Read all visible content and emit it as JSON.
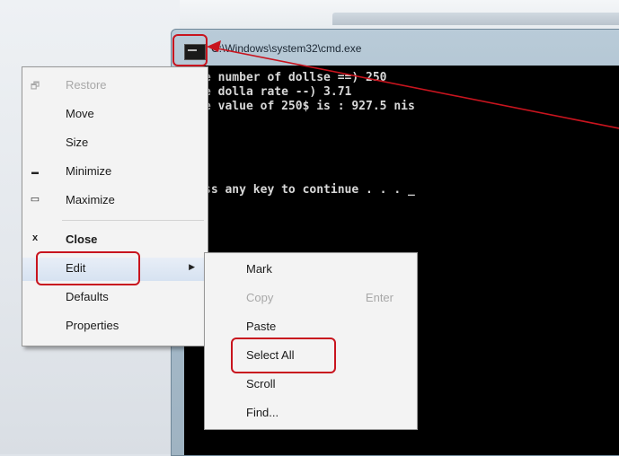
{
  "window": {
    "title": "C:\\Windows\\system32\\cmd.exe",
    "console_lines": [
      "e number of dollse ==) 250",
      "e dolla rate --) 3.71",
      "e value of 250$ is : 927.5 nis",
      "ss any key to continue . . . _"
    ]
  },
  "system_menu": {
    "items": [
      {
        "icon": "restore-icon",
        "glyph": "🗗",
        "label": "Restore",
        "enabled": false
      },
      {
        "icon": "",
        "glyph": "",
        "label": "Move",
        "enabled": true
      },
      {
        "icon": "",
        "glyph": "",
        "label": "Size",
        "enabled": true
      },
      {
        "icon": "minimize-icon",
        "glyph": "▬",
        "label": "Minimize",
        "enabled": true
      },
      {
        "icon": "maximize-icon",
        "glyph": "▭",
        "label": "Maximize",
        "enabled": true
      },
      {
        "icon": "close-icon",
        "glyph": "x",
        "label": "Close",
        "enabled": true
      },
      {
        "icon": "",
        "glyph": "",
        "label": "Edit",
        "enabled": true
      },
      {
        "icon": "",
        "glyph": "",
        "label": "Defaults",
        "enabled": true
      },
      {
        "icon": "",
        "glyph": "",
        "label": "Properties",
        "enabled": true
      }
    ],
    "submenu_arrow": "▶"
  },
  "edit_submenu": {
    "items": [
      {
        "label": "Mark",
        "shortcut": "",
        "enabled": true
      },
      {
        "label": "Copy",
        "shortcut": "Enter",
        "enabled": false
      },
      {
        "label": "Paste",
        "shortcut": "",
        "enabled": true
      },
      {
        "label": "Select All",
        "shortcut": "",
        "enabled": true
      },
      {
        "label": "Scroll",
        "shortcut": "",
        "enabled": true
      },
      {
        "label": "Find...",
        "shortcut": "",
        "enabled": true
      }
    ]
  },
  "annotation": {
    "color": "#c8141e"
  }
}
